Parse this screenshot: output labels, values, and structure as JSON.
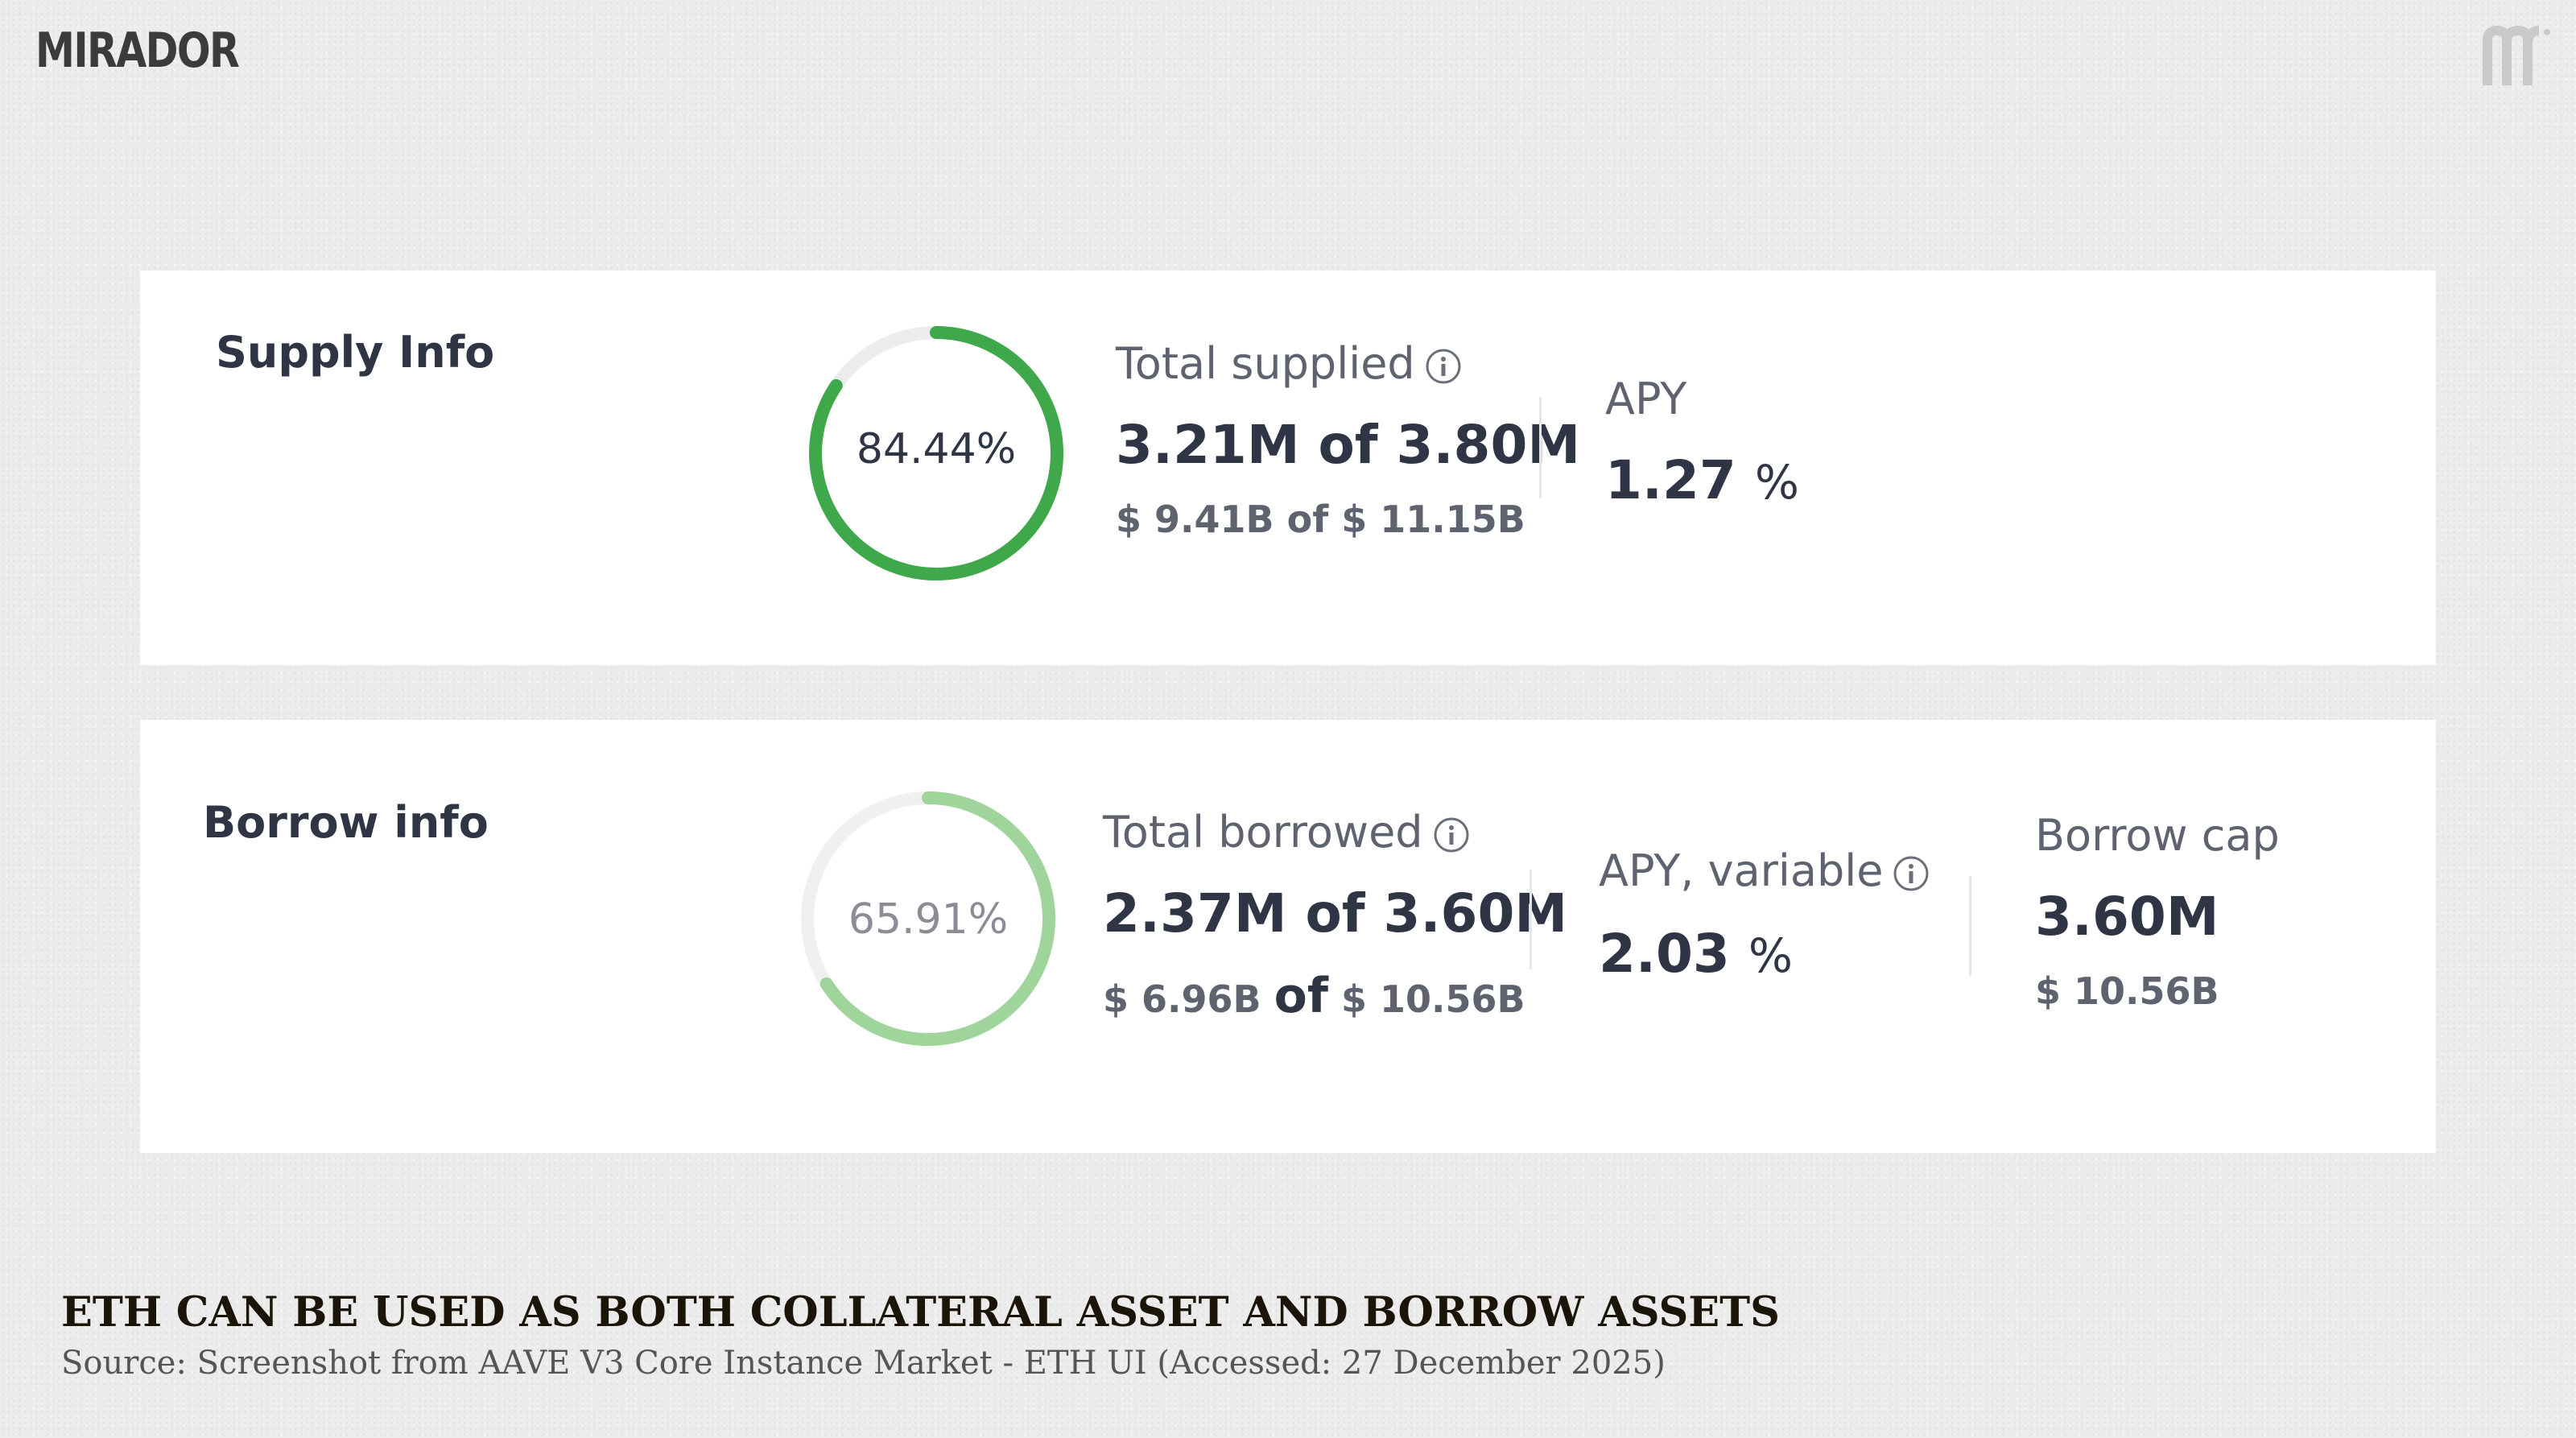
{
  "brand": {
    "logo_text": "MIRADOR",
    "monogram": "m"
  },
  "supply": {
    "title": "Supply Info",
    "utilization_pct": 84.44,
    "utilization_label": "84.44%",
    "total_label": "Total supplied",
    "total_value": "3.21M of 3.80M",
    "total_usd": "$ 9.41B of $ 11.15B",
    "apy_label": "APY",
    "apy_value": "1.27",
    "apy_unit": "%"
  },
  "borrow": {
    "title": "Borrow info",
    "utilization_pct": 65.91,
    "utilization_label": "65.91%",
    "total_label": "Total borrowed",
    "total_value": "2.37M of 3.60M",
    "total_usd_left": "$ 6.96B",
    "total_usd_of": "of",
    "total_usd_right": "$ 10.56B",
    "apy_label": "APY, variable",
    "apy_value": "2.03",
    "apy_unit": "%",
    "cap_label": "Borrow cap",
    "cap_value": "3.60M",
    "cap_usd": "$ 10.56B"
  },
  "caption": {
    "title": "ETH CAN BE USED AS BOTH COLLATERAL ASSET AND BORROW ASSETS",
    "source": "Source: Screenshot from AAVE V3 Core Instance Market - ETH UI (Accessed: 27 December 2025)"
  },
  "colors": {
    "supply_ring": "#3fa84a",
    "borrow_ring": "#9fd49b",
    "ring_track": "#ececec",
    "text_dark": "#2f3545",
    "text_muted": "#5f6370"
  }
}
